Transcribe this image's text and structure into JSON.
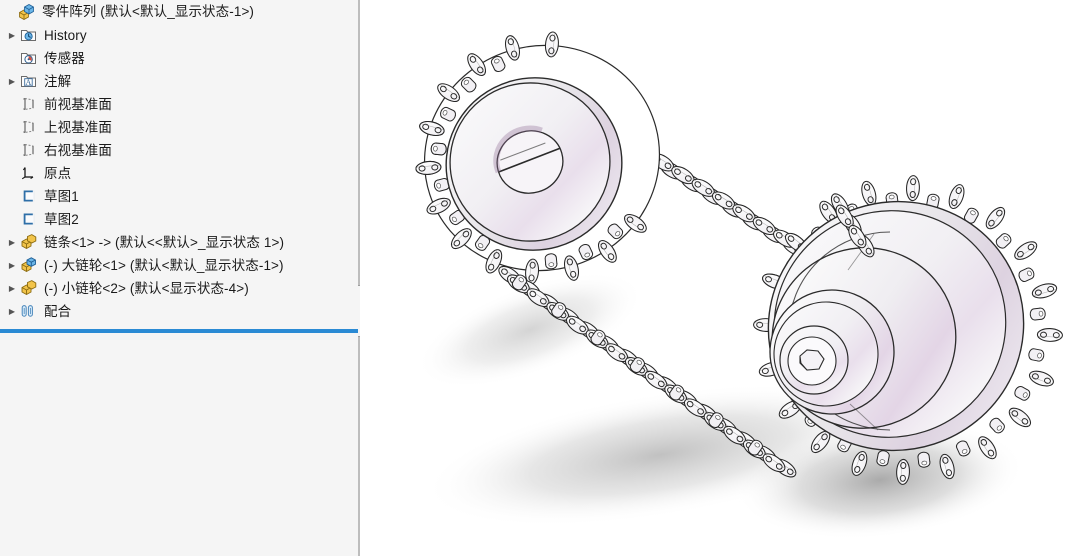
{
  "window": {
    "background_color": "#ffffff",
    "panel_color": "#f5f5f5",
    "accent_color": "#2a8ad4"
  },
  "feature_tree": {
    "root": {
      "label": "零件阵列  (默认<默认_显示状态-1>)",
      "icon": "assembly-icon",
      "expanded": true
    },
    "items": [
      {
        "label": "History",
        "icon": "history-folder-icon",
        "arrow": true,
        "indent": 1
      },
      {
        "label": "传感器",
        "icon": "sensor-folder-icon",
        "arrow": false,
        "indent": 1
      },
      {
        "label": "注解",
        "icon": "annotations-folder-icon",
        "arrow": true,
        "indent": 1
      },
      {
        "label": "前视基准面",
        "icon": "plane-icon",
        "arrow": false,
        "indent": 1
      },
      {
        "label": "上视基准面",
        "icon": "plane-icon",
        "arrow": false,
        "indent": 1
      },
      {
        "label": "右视基准面",
        "icon": "plane-icon",
        "arrow": false,
        "indent": 1
      },
      {
        "label": "原点",
        "icon": "origin-icon",
        "arrow": false,
        "indent": 1
      },
      {
        "label": "草图1",
        "icon": "sketch-icon",
        "arrow": false,
        "indent": 1
      },
      {
        "label": "草图2",
        "icon": "sketch-icon",
        "arrow": false,
        "indent": 1
      },
      {
        "label": "链条<1> -> (默认<<默认>_显示状态 1>)",
        "icon": "part-icon",
        "arrow": true,
        "indent": 1
      },
      {
        "label": "(-) 大链轮<1> (默认<默认_显示状态-1>)",
        "icon": "part-blue-icon",
        "arrow": true,
        "indent": 1
      },
      {
        "label": "(-) 小链轮<2> (默认<显示状态-4>)",
        "icon": "part-icon",
        "arrow": true,
        "indent": 1
      },
      {
        "label": "配合",
        "icon": "mates-icon",
        "arrow": true,
        "indent": 1
      }
    ]
  },
  "splitter": {
    "grip_icon": "splitter-grip-dot"
  },
  "graphics": {
    "model_name": "chain-and-sprocket-assembly",
    "components": [
      {
        "name": "small-sprocket",
        "label": "小链轮"
      },
      {
        "name": "large-sprocket",
        "label": "大链轮"
      },
      {
        "name": "roller-chain",
        "label": "链条"
      }
    ],
    "shading_color": "#efecf1",
    "edge_color": "#262626",
    "highlight_tint": "#e8d7ea",
    "shadow_color": "#9a9a9a"
  }
}
